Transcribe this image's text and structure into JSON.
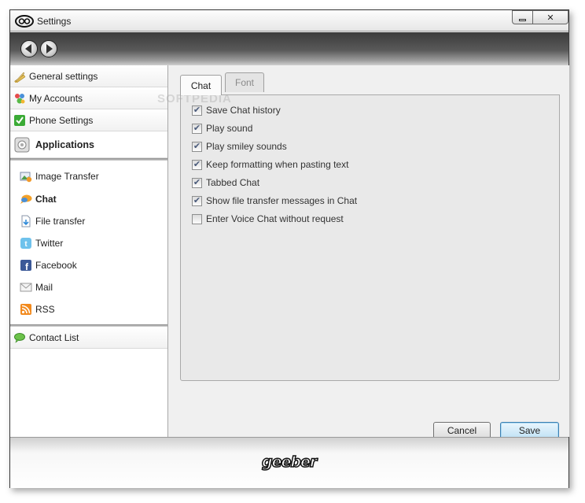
{
  "window": {
    "title": "Settings"
  },
  "navigation": {
    "back": "back",
    "forward": "forward"
  },
  "sidebar": {
    "items": [
      {
        "label": "General settings",
        "icon": "pencil-ruler-icon"
      },
      {
        "label": "My Accounts",
        "icon": "accounts-icon"
      },
      {
        "label": "Phone Settings",
        "icon": "green-check-icon"
      },
      {
        "label": "Applications",
        "icon": "applications-icon"
      }
    ],
    "sub_items": [
      {
        "label": "Image Transfer",
        "icon": "image-transfer-icon"
      },
      {
        "label": "Chat",
        "icon": "chat-bubble-icon"
      },
      {
        "label": "File transfer",
        "icon": "file-transfer-icon"
      },
      {
        "label": "Twitter",
        "icon": "twitter-icon"
      },
      {
        "label": "Facebook",
        "icon": "facebook-icon"
      },
      {
        "label": "Mail",
        "icon": "mail-icon"
      },
      {
        "label": "RSS",
        "icon": "rss-icon"
      }
    ],
    "contact_list": {
      "label": "Contact List",
      "icon": "contact-list-icon"
    }
  },
  "tabs": [
    {
      "label": "Chat",
      "active": true
    },
    {
      "label": "Font",
      "active": false
    }
  ],
  "watermark": "SOFTPEDIA",
  "options": [
    {
      "label": "Save Chat history",
      "checked": true
    },
    {
      "label": "Play sound",
      "checked": true
    },
    {
      "label": "Play smiley sounds",
      "checked": true
    },
    {
      "label": "Keep formatting when pasting text",
      "checked": true
    },
    {
      "label": "Tabbed Chat",
      "checked": true
    },
    {
      "label": "Show file transfer messages in Chat",
      "checked": true
    },
    {
      "label": "Enter Voice Chat without request",
      "checked": false
    }
  ],
  "buttons": {
    "cancel": "Cancel",
    "save": "Save"
  },
  "footer": {
    "logo": "geeber"
  },
  "colors": {
    "save_border": "#3c7fb1",
    "navbar_dark": "#3b3b3b",
    "checkmark": "#4a5a7a"
  }
}
